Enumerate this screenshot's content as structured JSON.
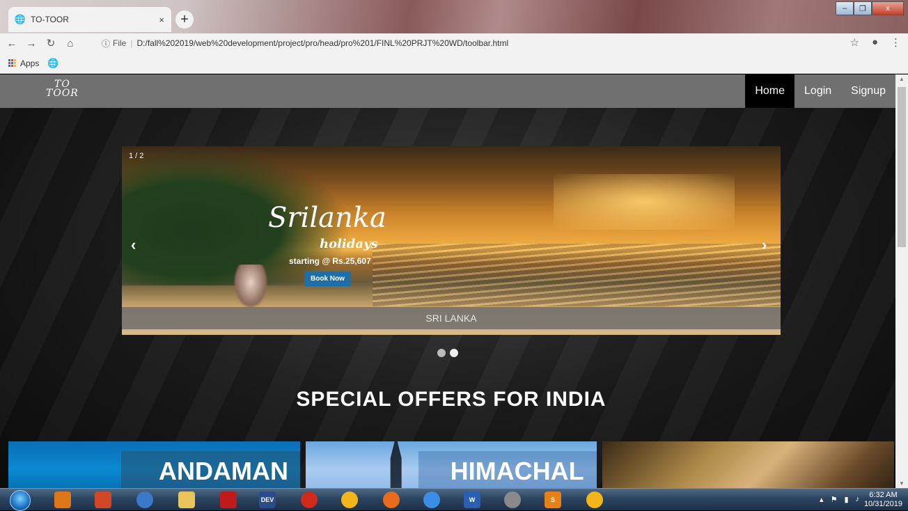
{
  "browser": {
    "tab_title": "TO-TOOR",
    "tab_close": "×",
    "new_tab": "+",
    "window_min": "–",
    "window_max": "❐",
    "window_close": "x",
    "omnibox_info": "ⓘ",
    "omnibox_scheme": "File",
    "url": "D:/fall%202019/web%20development/project/pro/head/pro%201/FINL%20PRJT%20WD/toolbar.html",
    "bookmarks_apps": "Apps"
  },
  "site": {
    "logo_line1": "TO",
    "logo_line2": "TOOR",
    "nav": [
      {
        "label": "Home",
        "active": true
      },
      {
        "label": "Login",
        "active": false
      },
      {
        "label": "Signup",
        "active": false
      }
    ]
  },
  "slideshow": {
    "counter": "1 / 2",
    "title_script": "Srilanka",
    "subtitle_script": "holidays",
    "price_text": "starting @ Rs.25,607",
    "book_label": "Book Now",
    "caption": "SRI LANKA",
    "prev": "‹",
    "next": "›",
    "dots": 2,
    "active_dot": 2
  },
  "offers": {
    "heading": "SPECIAL OFFERS FOR INDIA",
    "cards": [
      {
        "title": "ANDAMAN"
      },
      {
        "title": "HIMACHAL"
      },
      {
        "title": ""
      }
    ]
  },
  "taskbar": {
    "time": "6:32 AM",
    "date": "10/31/2019"
  },
  "colors": {
    "nav_bg": "#707070",
    "nav_active": "#000000",
    "book_button": "#1e6fa8"
  }
}
